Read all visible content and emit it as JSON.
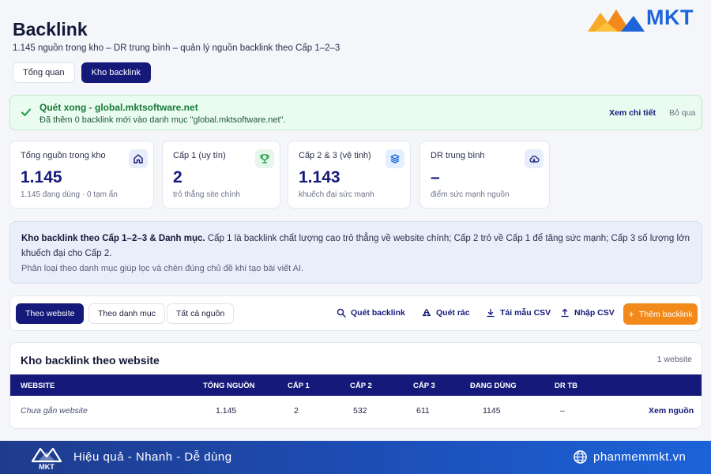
{
  "header": {
    "title": "Backlink",
    "subtitle": "1.145 nguồn trong kho – DR trung bình – quản lý nguồn backlink theo Cấp 1–2–3",
    "logo_text": "MKT"
  },
  "tabs": [
    {
      "label": "Tổng quan",
      "active": false
    },
    {
      "label": "Kho backlink",
      "active": true
    }
  ],
  "alert": {
    "title": "Quét xong - global.mktsoftware.net",
    "text": "Đã thêm 0 backlink mới vào danh mục \"global.mktsoftware.net\".",
    "detail_label": "Xem chi tiết",
    "skip_label": "Bỏ qua"
  },
  "stats": [
    {
      "label": "Tổng nguồn trong kho",
      "value": "1.145",
      "note": "1.145 đang dùng · 0 tạm ẩn",
      "icon": "home-icon"
    },
    {
      "label": "Cấp 1 (uy tín)",
      "value": "2",
      "note": "trỏ thẳng site chính",
      "icon": "trophy-icon"
    },
    {
      "label": "Cấp 2 & 3 (vệ tinh)",
      "value": "1.143",
      "note": "khuếch đại sức mạnh",
      "icon": "layers-icon"
    },
    {
      "label": "DR trung bình",
      "value": "–",
      "note": "điểm sức mạnh nguồn",
      "icon": "cloud-icon"
    }
  ],
  "info": {
    "heading": "Kho backlink theo Cấp 1–2–3 & Danh mục.",
    "body": " Cấp 1 là backlink chất lượng cao trỏ thẳng về website chính; Cấp 2 trỏ về Cấp 1 để tăng sức mạnh; Cấp 3 số lượng lớn khuếch đại cho Cấp 2.",
    "note": "Phân loại theo danh mục giúp lọc và chèn đúng chủ đề khi tạo bài viết AI."
  },
  "toolbar": {
    "filters": [
      {
        "label": "Theo website",
        "active": true
      },
      {
        "label": "Theo danh mục",
        "active": false
      },
      {
        "label": "Tất cả nguồn",
        "active": false
      }
    ],
    "scan_label": "Quét backlink",
    "clean_label": "Quét rác",
    "template_label": "Tải mẫu CSV",
    "import_label": "Nhập CSV",
    "add_label": "Thêm backlink"
  },
  "table": {
    "title": "Kho backlink theo website",
    "count": "1 website",
    "columns": [
      "WEBSITE",
      "TỔNG NGUỒN",
      "CẤP 1",
      "CẤP 2",
      "CẤP 3",
      "ĐANG DÙNG",
      "DR TB"
    ],
    "rows": [
      {
        "website": "Chưa gắn website",
        "total": "1.145",
        "cap1": "2",
        "cap2": "532",
        "cap3": "611",
        "active": "1145",
        "dr": "–",
        "action": "Xem nguồn"
      }
    ]
  },
  "footer": {
    "tagline": "Hiệu quả - Nhanh - Dễ dùng",
    "website": "phanmemmkt.vn"
  },
  "colors": {
    "primary": "#15197a",
    "accent": "#f28a1b",
    "success": "#177a3a",
    "footer": "#1d4fb8"
  }
}
